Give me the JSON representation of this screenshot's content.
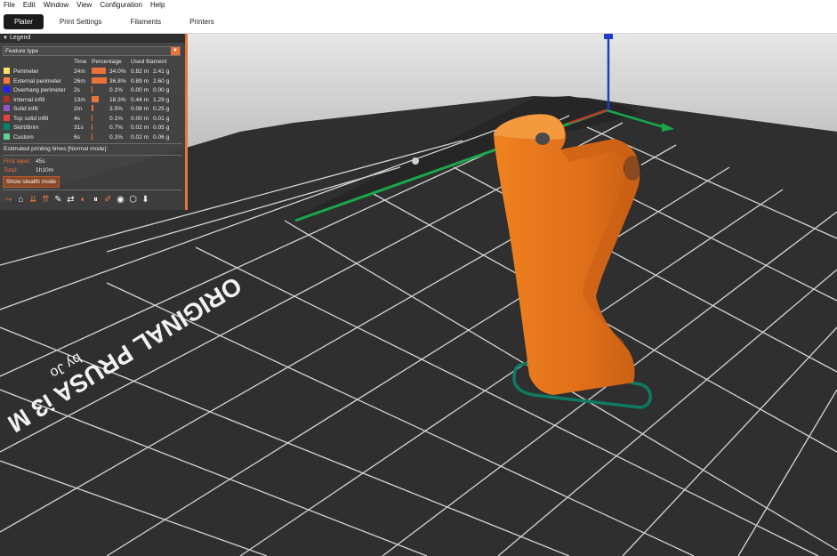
{
  "menu": [
    "File",
    "Edit",
    "Window",
    "View",
    "Configuration",
    "Help"
  ],
  "tabs": [
    "Plater",
    "Print Settings",
    "Filaments",
    "Printers"
  ],
  "legend": {
    "title": "Legend",
    "view_type": "Feature type",
    "columns": [
      "Time",
      "Percentage",
      "Used filament"
    ],
    "rows": [
      {
        "name": "Perimeter",
        "time": "24m",
        "percent": "34.0%",
        "pct": 34.0,
        "length": "0.82 m",
        "weight": "2.41 g",
        "color": "#ffe566"
      },
      {
        "name": "External perimeter",
        "time": "26m",
        "percent": "36.8%",
        "pct": 36.8,
        "length": "0.89 m",
        "weight": "2.60 g",
        "color": "#ff7d38"
      },
      {
        "name": "Overhang perimeter",
        "time": "2s",
        "percent": "0.1%",
        "pct": 0.1,
        "length": "0.00 m",
        "weight": "0.00 g",
        "color": "#1f1fff"
      },
      {
        "name": "Internal infill",
        "time": "13m",
        "percent": "18.3%",
        "pct": 18.3,
        "length": "0.44 m",
        "weight": "1.29 g",
        "color": "#b03029"
      },
      {
        "name": "Solid infill",
        "time": "2m",
        "percent": "3.5%",
        "pct": 3.5,
        "length": "0.08 m",
        "weight": "0.25 g",
        "color": "#9654cc"
      },
      {
        "name": "Top solid infill",
        "time": "4s",
        "percent": "0.1%",
        "pct": 0.1,
        "length": "0.00 m",
        "weight": "0.01 g",
        "color": "#f04040"
      },
      {
        "name": "Skirt/Brim",
        "time": "31s",
        "percent": "0.7%",
        "pct": 0.7,
        "length": "0.02 m",
        "weight": "0.05 g",
        "color": "#00876e"
      },
      {
        "name": "Custom",
        "time": "6s",
        "percent": "0.1%",
        "pct": 0.1,
        "length": "0.02 m",
        "weight": "0.06 g",
        "color": "#5ed194"
      }
    ],
    "estimated_title": "Estimated printing times [Normal mode]:",
    "first_layer_label": "First layer:",
    "first_layer_value": "45s",
    "total_label": "Total:",
    "total_value": "1h10m",
    "stealth_button": "Show stealth mode",
    "toolbar_icons": [
      "travel-icon",
      "wipe-icon",
      "retractions-icon",
      "deretractions-icon",
      "seams-icon",
      "tool-changes-icon",
      "color-changes-icon",
      "pause-prints-icon",
      "custom-gcodes-icon",
      "center-of-gravity-icon",
      "shells-icon",
      "tool-marker-icon"
    ]
  },
  "bed": {
    "printer_label": "ORIGINAL PRUSA i3 M",
    "author_label": "by Jo"
  },
  "colors": {
    "accent": "#e9743a",
    "model": "#e8731f",
    "bed": "#2f2f2f",
    "grid": "#f2f2f2"
  }
}
